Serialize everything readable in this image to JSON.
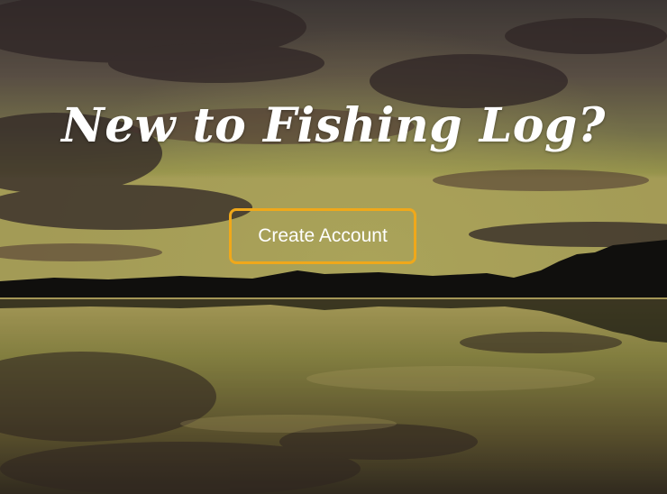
{
  "hero": {
    "headline": "New to Fishing Log?",
    "cta_label": "Create Account",
    "accent_color": "#f0a81a",
    "background_scene": "lake sunset with treeline reflection"
  }
}
